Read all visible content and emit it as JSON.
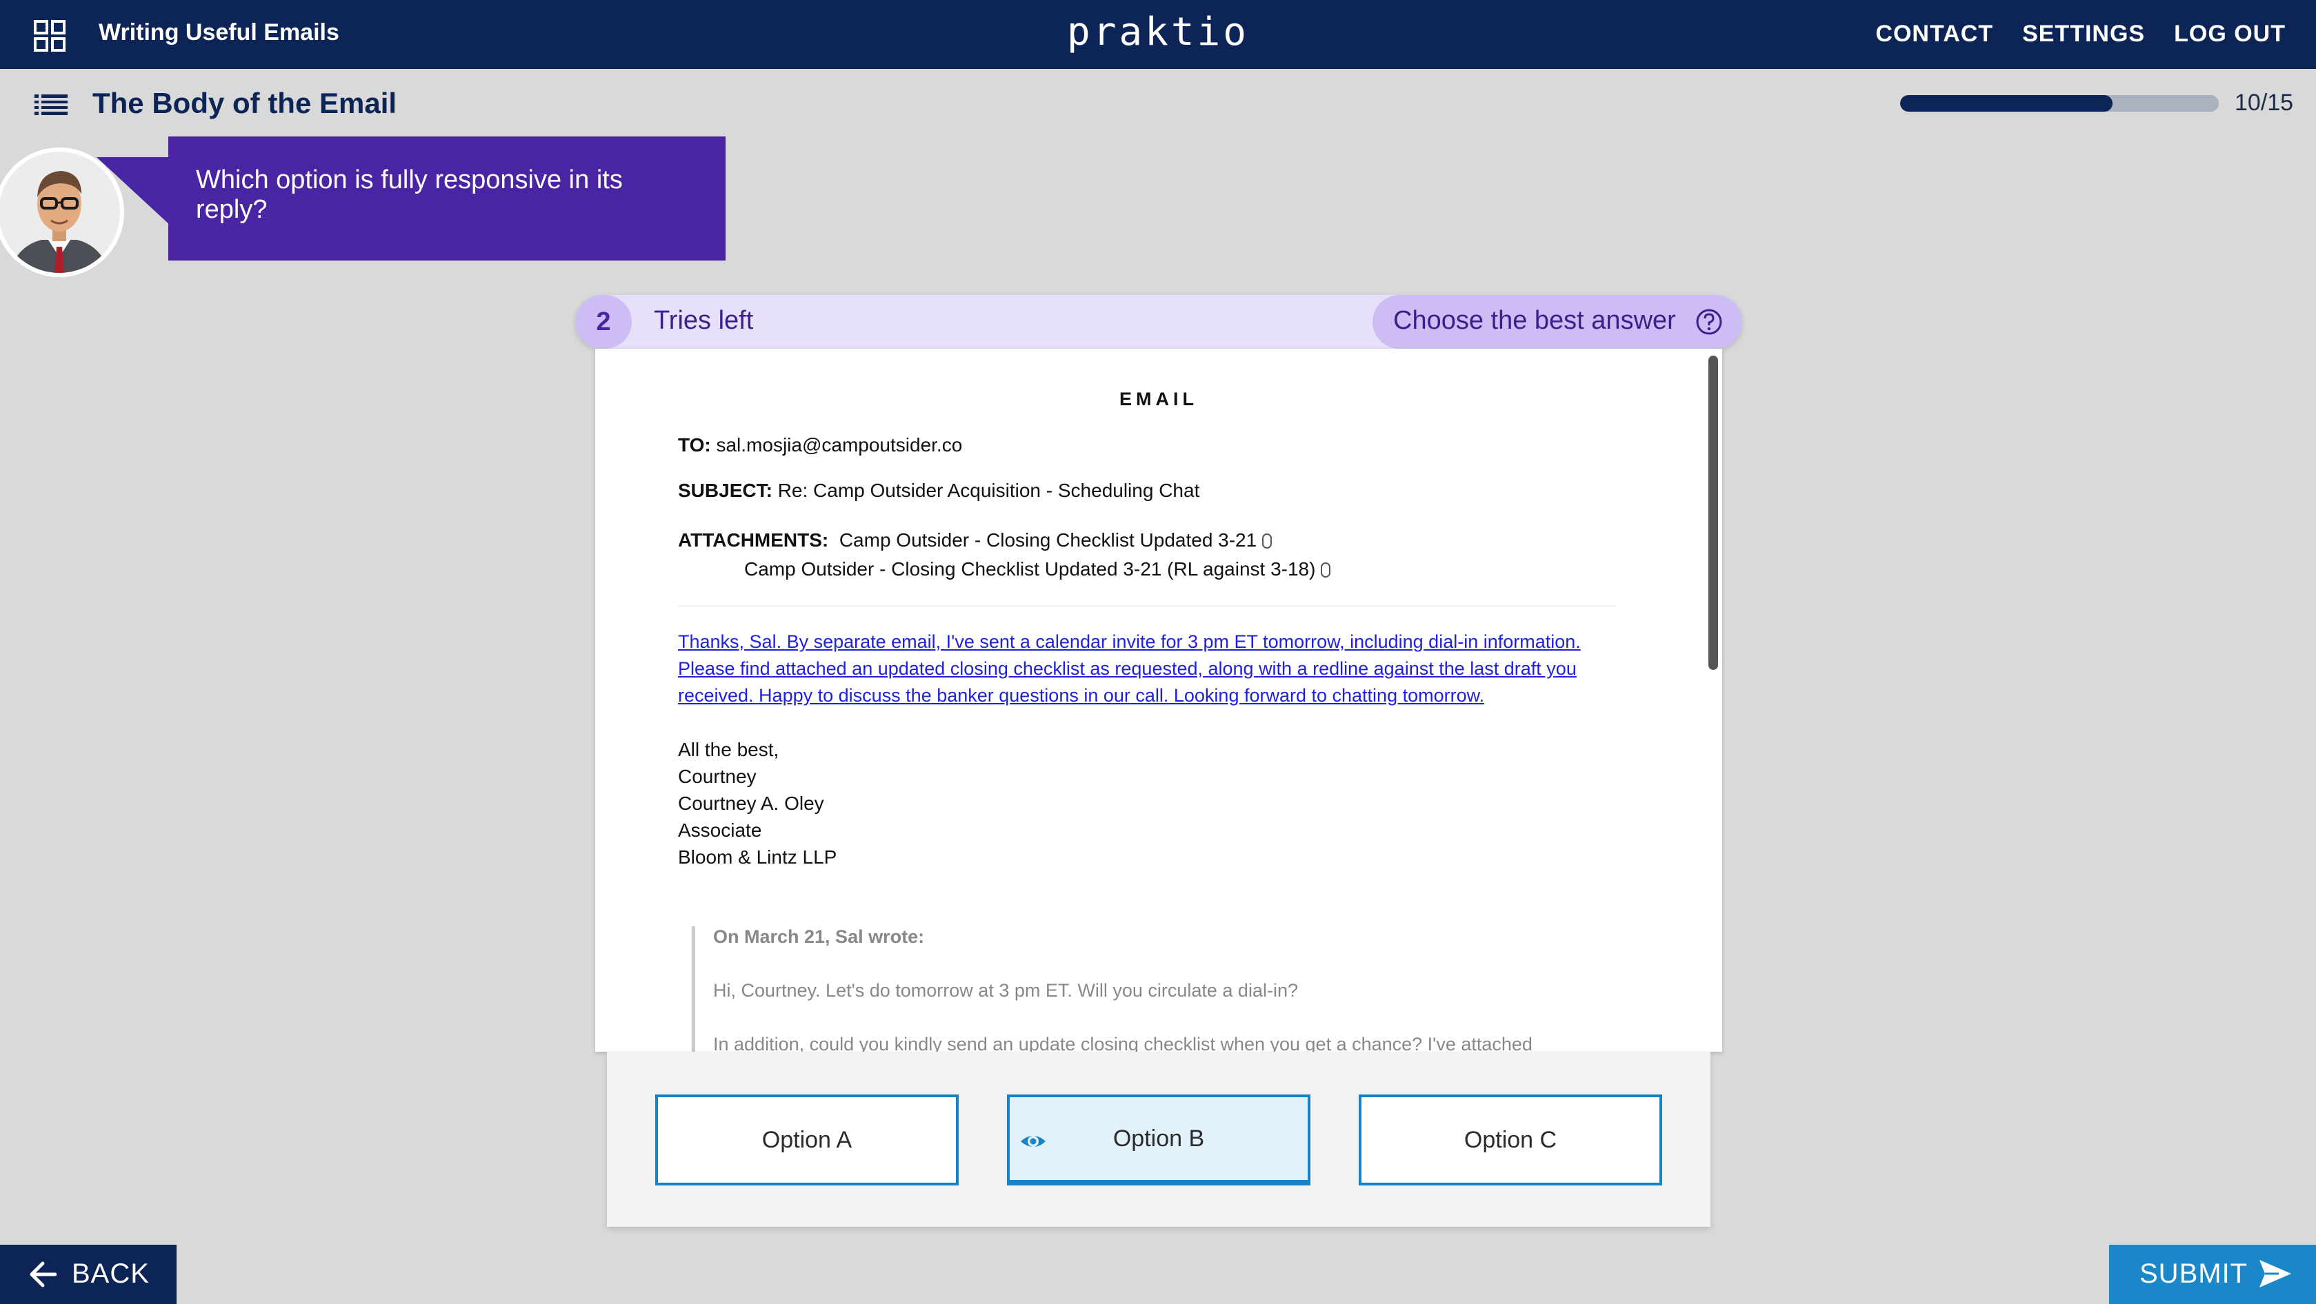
{
  "header": {
    "course_title": "Writing Useful Emails",
    "logo_text": "praktio",
    "nav": [
      "CONTACT",
      "SETTINGS",
      "LOG OUT"
    ]
  },
  "lesson": {
    "title": "The Body of the Email",
    "progress_text": "10/15",
    "progress_fraction": 0.667
  },
  "prompt": {
    "question": "Which option is fully responsive in its reply?"
  },
  "status": {
    "tries_count": "2",
    "tries_label": "Tries left",
    "instruction": "Choose the best answer"
  },
  "email": {
    "heading": "EMAIL",
    "to_label": "TO:",
    "to_value": "sal.mosjia@campoutsider.co",
    "subject_label": "SUBJECT:",
    "subject_value": "Re: Camp Outsider Acquisition - Scheduling Chat",
    "attachments_label": "ATTACHMENTS:",
    "attachments": [
      "Camp Outsider - Closing Checklist Updated 3-21",
      "Camp Outsider - Closing Checklist Updated 3-21 (RL against 3-18)"
    ],
    "reply_lines": [
      "Thanks, Sal. By separate email, I've sent a calendar invite for 3 pm ET tomorrow, including dial-in information.",
      "Please find attached an updated closing checklist as requested, along with a redline against the last draft you",
      "received. Happy to discuss the banker questions in our call. Looking forward to chatting tomorrow."
    ],
    "closing": [
      "All the best,",
      "Courtney"
    ],
    "signature": [
      "Courtney A. Oley",
      "Associate",
      "Bloom & Lintz LLP"
    ],
    "quote_header": "On March 21, Sal wrote:",
    "quote_lines": [
      "Hi, Courtney. Let's do tomorrow at 3 pm ET. Will you circulate a dial-in?",
      "In addition, could you kindly send an update closing checklist when you get a chance? I've attached"
    ]
  },
  "options": [
    {
      "label": "Option A",
      "selected": false
    },
    {
      "label": "Option B",
      "selected": true
    },
    {
      "label": "Option C",
      "selected": false
    }
  ],
  "footer": {
    "back_label": "BACK",
    "submit_label": "SUBMIT"
  },
  "colors": {
    "navy": "#0d2456",
    "purple": "#4a25a3",
    "lavender": "#e7e0fa",
    "accent_blue": "#1a87c9",
    "link_blue": "#1f1fe0"
  },
  "icons": [
    "grid-icon",
    "list-icon",
    "help-icon",
    "eye-icon",
    "paperclip-icon",
    "arrow-left-icon",
    "send-icon"
  ]
}
